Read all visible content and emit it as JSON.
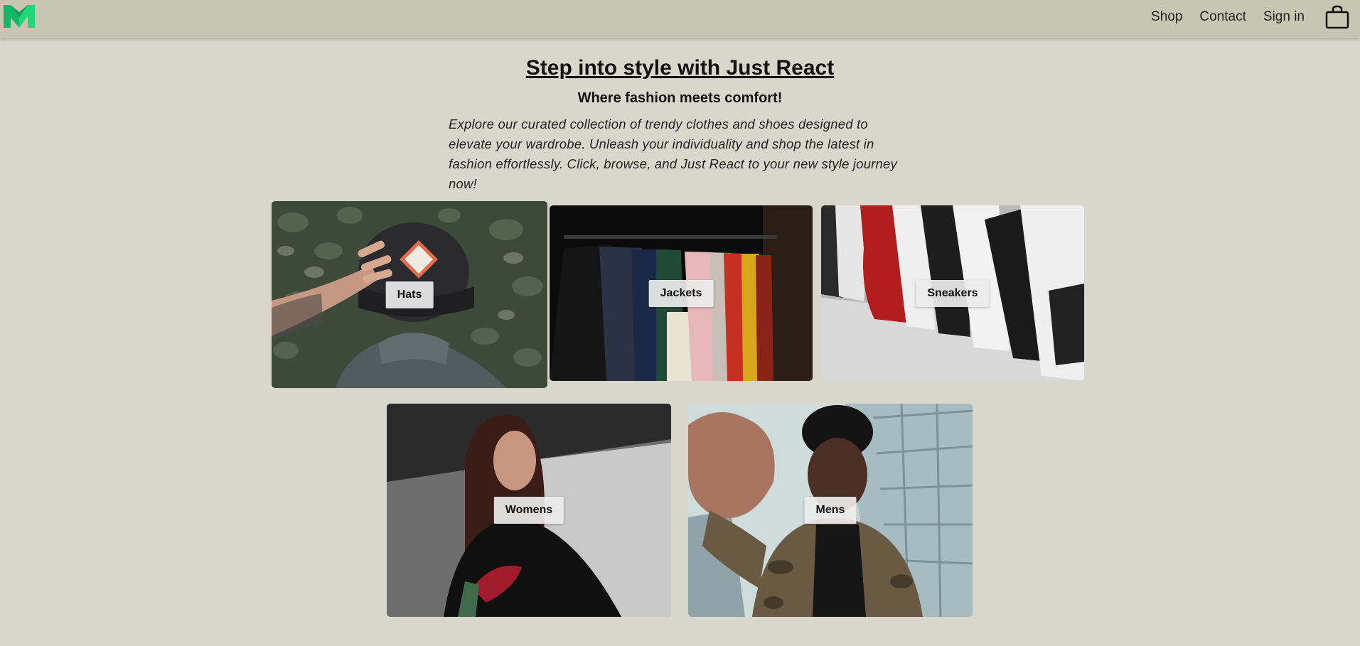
{
  "nav": {
    "logo_icon": "crown-logo-icon",
    "links": [
      "Shop",
      "Contact",
      "Sign in"
    ],
    "cart_icon": "shopping-bag-icon"
  },
  "hero": {
    "title": "Step into style with Just React",
    "subtitle": "Where fashion meets comfort!",
    "description": "Explore our curated collection of trendy clothes and shoes designed to elevate your wardrobe. Unleash your individuality and shop the latest in fashion effortlessly. Click, browse, and Just React to your new style journey now!"
  },
  "categories": [
    {
      "label": "Hats"
    },
    {
      "label": "Jackets"
    },
    {
      "label": "Sneakers"
    },
    {
      "label": "Womens"
    },
    {
      "label": "Mens"
    }
  ],
  "colors": {
    "background": "#d9d7cb",
    "navbar": "#c5c7b2",
    "logo_green": "#1fd67a"
  }
}
